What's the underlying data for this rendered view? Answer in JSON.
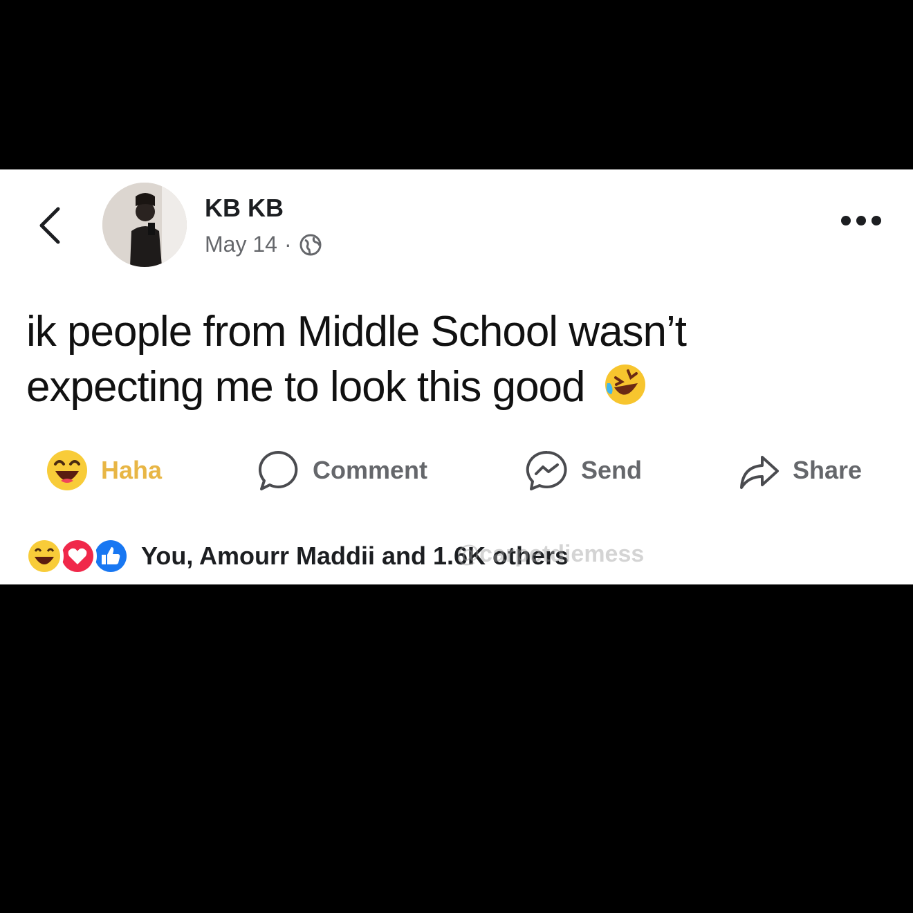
{
  "post": {
    "author": "KB KB",
    "date": "May 14",
    "separator": "·",
    "privacy_icon": "globe-icon",
    "text": "ik people from Middle School wasn’t expecting me to look this good",
    "inline_emoji": "rolling-on-floor-laughing-icon"
  },
  "actions": {
    "haha": "Haha",
    "comment": "Comment",
    "send": "Send",
    "share": "Share"
  },
  "reactions": {
    "icons": [
      "haha-icon",
      "love-icon",
      "like-icon"
    ],
    "summary": "You, Amourr Maddii and 1.6K others"
  },
  "watermark": "@carpetdiemess",
  "colors": {
    "haha_yellow": "#e8b645",
    "love_red": "#f0284a",
    "like_blue": "#1877f2",
    "muted_text": "#65676b"
  }
}
